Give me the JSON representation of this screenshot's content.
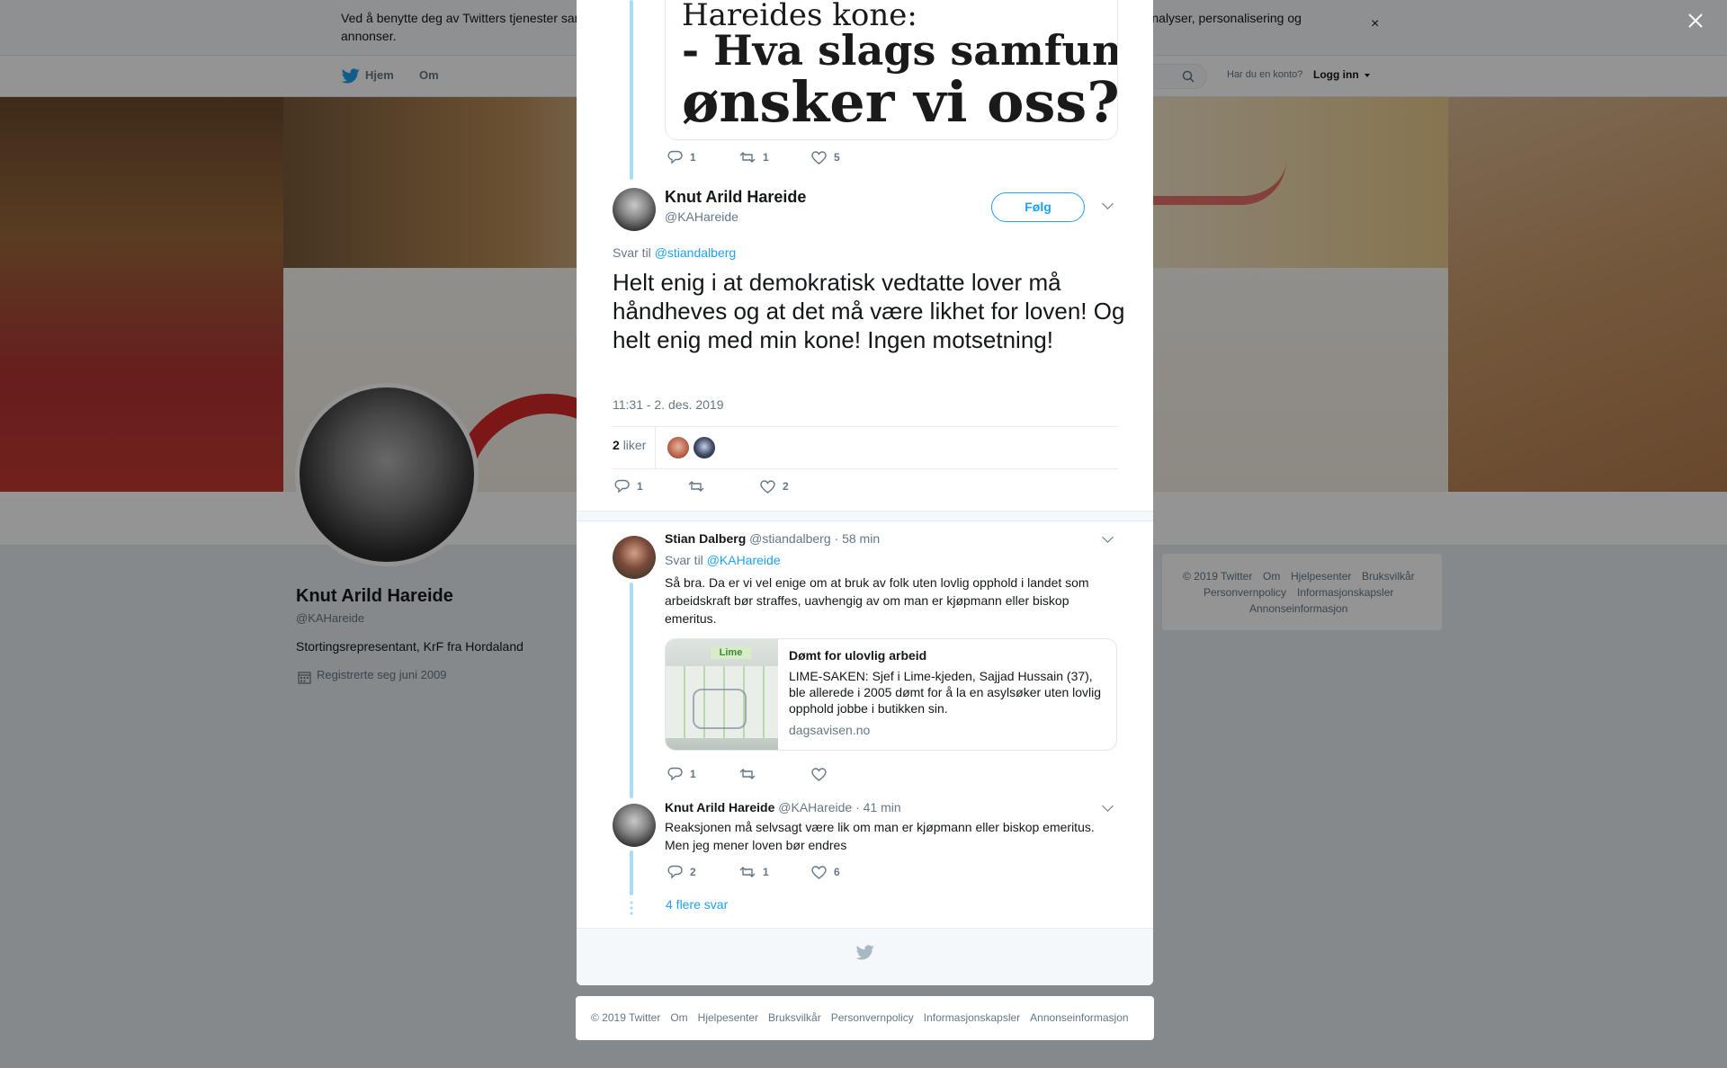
{
  "cookie_bar": {
    "text": "Ved å benytte deg av Twitters tjenester samtykker du i at vi bruker informasjonskapsler. Vi og våre partnere benytter informasjonskapsler til bl.a. analyser, personalisering og annonser.",
    "close": "×"
  },
  "nav": {
    "home": "Hjem",
    "about": "Om",
    "account_prompt": "Har du en konto?",
    "login": "Logg inn"
  },
  "profile": {
    "name": "Knut Arild Hareide",
    "handle": "@KAHareide",
    "bio": "Stortingsrepresentant, KrF fra Hordaland",
    "joined": "Registrerte seg juni 2009"
  },
  "right_footer": {
    "row1": [
      "© 2019 Twitter",
      "Om",
      "Hjelpesenter",
      "Bruksvilkår"
    ],
    "row2": [
      "Personvernpolicy",
      "Informasjonskapsler"
    ],
    "row3": [
      "Annonseinformasjon"
    ]
  },
  "modal": {
    "parent_image_lines": [
      "Hareides kone:",
      "- Hva slags samfunn",
      "ønsker vi oss?"
    ],
    "parent_actions": {
      "replies": "1",
      "retweets": "1",
      "likes": "5"
    },
    "main": {
      "name": "Knut Arild Hareide",
      "handle": "@KAHareide",
      "follow": "Følg",
      "reply_prefix": "Svar til",
      "reply_to": "@stiandalberg",
      "text": "Helt enig i at demokratisk vedtatte lover må håndheves og at det må være likhet for loven! Og helt enig med min kone! Ingen motsetning!",
      "timestamp": "11:31 - 2. des. 2019",
      "likes_count": "2",
      "likes_label": "liker",
      "actions": {
        "replies": "1",
        "retweets": "",
        "likes": "2"
      }
    },
    "replies": [
      {
        "name": "Stian Dalberg",
        "handle": "@stiandalberg",
        "time": "· 58 min",
        "reply_prefix": "Svar til",
        "reply_to": "@KAHareide",
        "text": "Så bra. Da er vi vel enige om at bruk av folk uten lovlig opphold i landet som arbeidskraft bør straffes, uavhengig av om man er kjøpmann eller biskop emeritus.",
        "card": {
          "title": "Dømt for ulovlig arbeid",
          "description": "LIME-SAKEN: Sjef i Lime-kjeden, Sajjad Hussain (37), ble allerede i 2005 dømt for å la en asylsøker uten lovlig opphold jobbe i butikken sin.",
          "domain": "dagsavisen.no",
          "image_sign": "Lime"
        },
        "actions": {
          "replies": "1",
          "retweets": "",
          "likes": ""
        }
      },
      {
        "name": "Knut Arild Hareide",
        "handle": "@KAHareide",
        "time": "· 41 min",
        "text": "Reaksjonen må selvsagt være lik om man er kjøpmann eller biskop emeritus. Men jeg mener loven bør endres",
        "actions": {
          "replies": "2",
          "retweets": "1",
          "likes": "6"
        }
      }
    ],
    "more_replies": "4 flere svar"
  },
  "bottom_footer": [
    "© 2019 Twitter",
    "Om",
    "Hjelpesenter",
    "Bruksvilkår",
    "Personvernpolicy",
    "Informasjonskapsler",
    "Annonseinformasjon"
  ],
  "colors": {
    "accent": "#1da1f2",
    "thread_line": "#a9dcf7",
    "muted": "#657786"
  }
}
